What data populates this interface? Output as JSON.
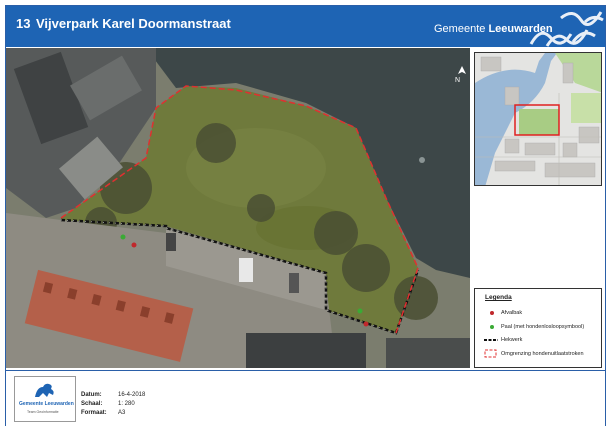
{
  "header": {
    "number": "13",
    "title": "Vijverpark Karel Doormanstraat",
    "logo_prefix": "Gemeente",
    "logo_name": "Leeuwarden"
  },
  "map": {
    "north_label": "N"
  },
  "legend": {
    "title": "Legenda",
    "items": [
      {
        "label": "Afvalbak",
        "symbol": "red-dot",
        "color": "#c0282c"
      },
      {
        "label": "Paal (met hondenlosloopsymbool)",
        "symbol": "green-dot",
        "color": "#3aaa35"
      },
      {
        "label": "Hekwerk",
        "symbol": "black-dashed-line",
        "color": "#111111"
      },
      {
        "label": "Omgrenzing hondenuitlaatstroken",
        "symbol": "red-dashed-line",
        "color": "#e03030"
      }
    ]
  },
  "footer": {
    "logo_prefix": "Gemeente",
    "logo_name": "Leeuwarden",
    "logo_sub": "Team Geoinformatie",
    "fields": [
      {
        "label": "Datum:",
        "value": "16-4-2018"
      },
      {
        "label": "Schaal:",
        "value": "1: 280"
      },
      {
        "label": "Formaat:",
        "value": "A3"
      }
    ]
  },
  "colors": {
    "brand_blue": "#1e64b4",
    "water": "#3a4446",
    "grass": "#6f7b3e"
  }
}
